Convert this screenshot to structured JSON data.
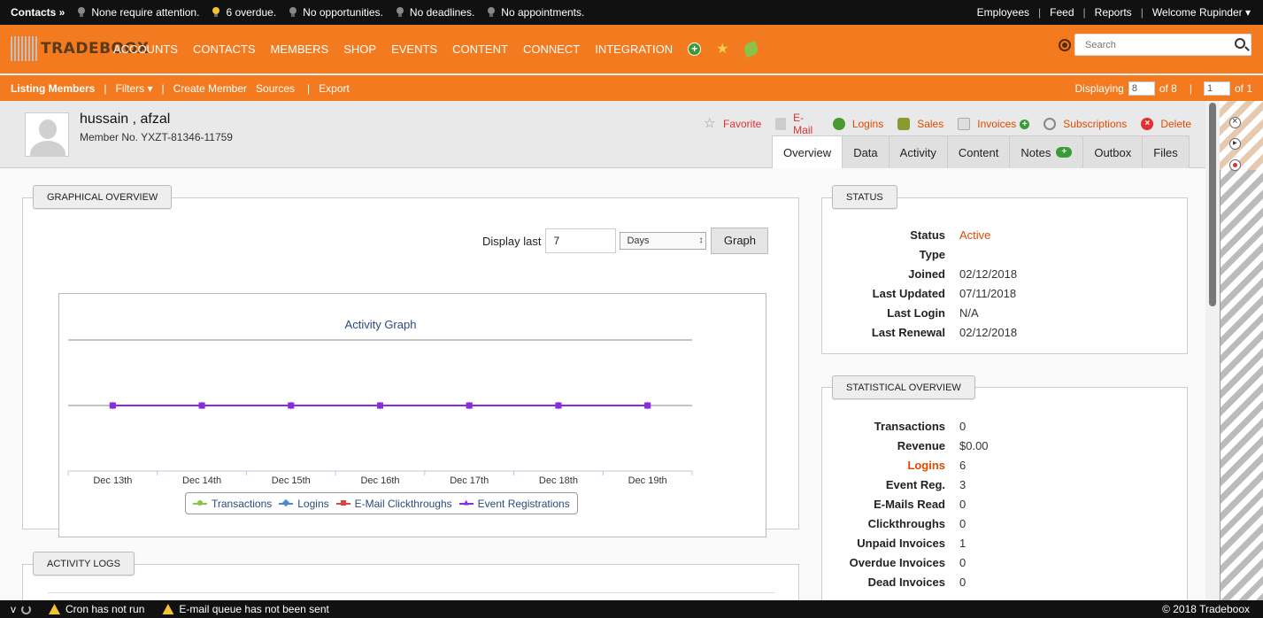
{
  "topbar": {
    "contacts": "Contacts »",
    "alerts": [
      "None require attention.",
      "6 overdue.",
      "No opportunities.",
      "No deadlines.",
      "No appointments."
    ],
    "links": [
      "Employees",
      "Feed",
      "Reports",
      "Welcome Rupinder ▾"
    ]
  },
  "nav": {
    "logo": "TRADEBOOX",
    "items": [
      "ACCOUNTS",
      "CONTACTS",
      "MEMBERS",
      "SHOP",
      "EVENTS",
      "CONTENT",
      "CONNECT",
      "INTEGRATION"
    ],
    "search_placeholder": "Search"
  },
  "subbar": {
    "listing": "Listing Members",
    "sep": "|",
    "filters": "Filters ▾",
    "create": "Create Member",
    "sources": "Sources",
    "export": "Export",
    "displaying": "Displaying",
    "per_page": "8",
    "of_total": "of 8",
    "page": "1",
    "of_pages": "of 1"
  },
  "profile": {
    "name": "hussain , afzal",
    "member_no": "Member No. YXZT-81346-11759",
    "actions": [
      "Favorite",
      "E-Mail",
      "Logins",
      "Sales",
      "Invoices",
      "Subscriptions",
      "Delete"
    ],
    "tabs": [
      "Overview",
      "Data",
      "Activity",
      "Content",
      "Notes",
      "Outbox",
      "Files"
    ]
  },
  "graphical": {
    "title": "GRAPHICAL OVERVIEW",
    "display_last": "Display last",
    "display_value": "7",
    "period": "Days",
    "graph_button": "Graph"
  },
  "chart_data": {
    "type": "line",
    "title": "Activity Graph",
    "categories": [
      "Dec 13th",
      "Dec 14th",
      "Dec 15th",
      "Dec 16th",
      "Dec 17th",
      "Dec 18th",
      "Dec 19th"
    ],
    "series": [
      {
        "name": "Transactions",
        "values": [
          0,
          0,
          0,
          0,
          0,
          0,
          0
        ],
        "color": "#8bc34a"
      },
      {
        "name": "Logins",
        "values": [
          0,
          0,
          0,
          0,
          0,
          0,
          0
        ],
        "color": "#4a8ad0"
      },
      {
        "name": "E-Mail Clickthroughs",
        "values": [
          0,
          0,
          0,
          0,
          0,
          0,
          0
        ],
        "color": "#e04040"
      },
      {
        "name": "Event Registrations",
        "values": [
          0,
          0,
          0,
          0,
          0,
          0,
          0
        ],
        "color": "#8a2be2"
      }
    ],
    "ylim": [
      -1,
      1
    ],
    "grid": true,
    "legend": "bottom"
  },
  "status": {
    "title": "STATUS",
    "rows": [
      {
        "k": "Status",
        "v": "Active"
      },
      {
        "k": "Type",
        "v": ""
      },
      {
        "k": "Joined",
        "v": "02/12/2018"
      },
      {
        "k": "Last Updated",
        "v": "07/11/2018"
      },
      {
        "k": "Last Login",
        "v": "N/A"
      },
      {
        "k": "Last Renewal",
        "v": "02/12/2018"
      }
    ]
  },
  "stats": {
    "title": "STATISTICAL OVERVIEW",
    "rows": [
      {
        "k": "Transactions",
        "v": "0"
      },
      {
        "k": "Revenue",
        "v": "$0.00"
      },
      {
        "k": "Logins",
        "v": "6"
      },
      {
        "k": "Event Reg.",
        "v": "3"
      },
      {
        "k": "E-Mails Read",
        "v": "0"
      },
      {
        "k": "Clickthroughs",
        "v": "0"
      },
      {
        "k": "Unpaid Invoices",
        "v": "1"
      },
      {
        "k": "Overdue Invoices",
        "v": "0"
      },
      {
        "k": "Dead Invoices",
        "v": "0"
      }
    ]
  },
  "activity_logs": {
    "title": "ACTIVITY LOGS"
  },
  "bottombar": {
    "version": "v",
    "cron": "Cron has not run",
    "email_queue": "E-mail queue has not been sent",
    "copyright": "© 2018 Tradeboox"
  },
  "colors": {
    "accent": "#f47a20",
    "dark": "#111111",
    "link_red": "#e04a00"
  }
}
